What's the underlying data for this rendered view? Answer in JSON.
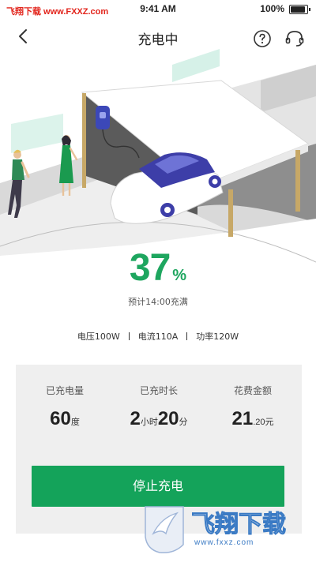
{
  "status_bar": {
    "watermark": "飞翔下载 www.FXXZ.com",
    "time": "9:41 AM",
    "battery_percent": "100%",
    "battery_level": 1.0
  },
  "nav": {
    "title": "充电中",
    "icons": {
      "back": "chevron-left-icon",
      "help": "question-circle-icon",
      "support": "headset-icon"
    }
  },
  "progress": {
    "percent": "37",
    "percent_unit": "%",
    "eta": "预计14:00充满"
  },
  "metrics": {
    "voltage": "电压100W",
    "current": "电流110A",
    "power": "功率120W"
  },
  "stats": {
    "charged": {
      "label": "已充电量",
      "value": "60",
      "unit": "度"
    },
    "duration": {
      "label": "已充时长",
      "hours": "2",
      "hours_unit": "小时",
      "minutes": "20",
      "minutes_unit": "分"
    },
    "cost": {
      "label": "花费金额",
      "integer": "21",
      "decimal": ".20",
      "unit": "元"
    }
  },
  "actions": {
    "stop_label": "停止充电"
  },
  "watermark": {
    "brand": "飞翔下载",
    "url": "www.fxxz.com"
  },
  "colors": {
    "accent": "#1ea65f",
    "button": "#14a35a",
    "card_bg": "#efefef",
    "watermark_red": "#e2231a"
  }
}
